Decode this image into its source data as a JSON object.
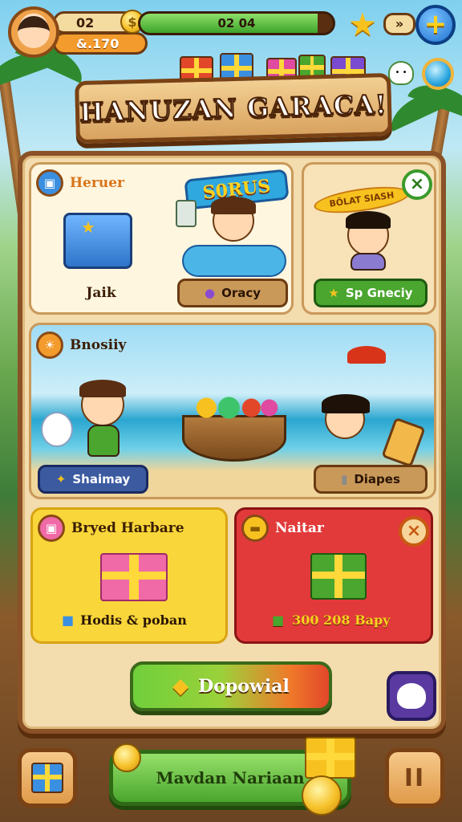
{
  "hud": {
    "level_value": "02",
    "coins_value": "&.170",
    "progress_text": "02 04",
    "progress_fraction": 0.92,
    "chevron_label": "»",
    "add_label": "+"
  },
  "title": "HANUZAN GARACA!",
  "cards": {
    "treasure": {
      "title": "Heruer",
      "chest_label": "Jaik",
      "badge": "S0RUS",
      "button_label": "Oracy"
    },
    "special": {
      "badge": "BÖLAT SIASH",
      "button_label": "Sp Gneciy",
      "close": "×"
    },
    "beach": {
      "title": "Bnosiiy",
      "left_button": "Shaimay",
      "right_button": "Diapes"
    },
    "yellow": {
      "title": "Bryed Harbare",
      "footer": "Hodis & poban"
    },
    "red": {
      "title": "Naitar",
      "footer": "300 208 Bapy",
      "close": "×"
    }
  },
  "action_button": "Dopowial",
  "bottom_nav": {
    "main_label": "Mavdan Nariaan",
    "pause_label": "II"
  },
  "colors": {
    "accent_green": "#4aa62e",
    "accent_orange": "#f39b2c",
    "wood": "#8a5226",
    "red_card": "#e23a3a",
    "yellow_card": "#f9d63a"
  }
}
